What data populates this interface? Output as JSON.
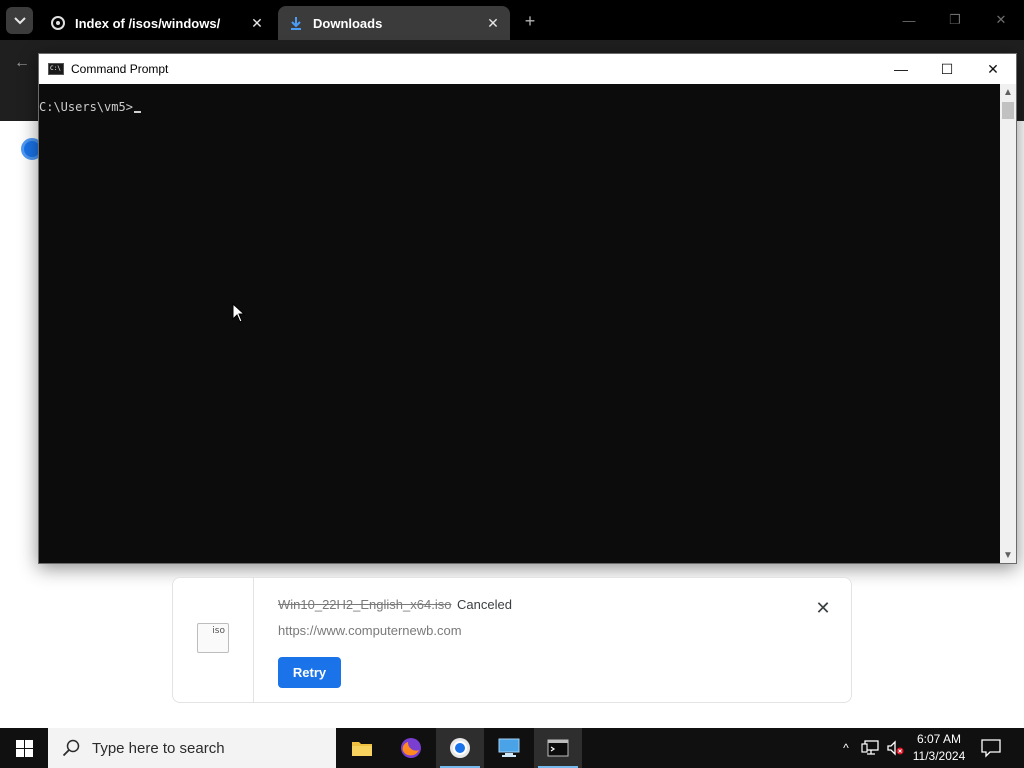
{
  "browser": {
    "tabs": [
      {
        "title": "Index of /isos/windows/",
        "active": false
      },
      {
        "title": "Downloads",
        "active": true
      }
    ],
    "new_tab_symbol": "+",
    "window_controls": {
      "minimize": "—",
      "restore": "❐",
      "close": "✕"
    },
    "back_symbol": "←"
  },
  "cmd": {
    "title": "Command Prompt",
    "prompt": "C:\\Users\\vm5>",
    "controls": {
      "minimize": "—",
      "maximize": "☐",
      "close": "✕"
    },
    "scroll_up": "▲",
    "scroll_down": "▼"
  },
  "download": {
    "file_name": "Win10_22H2_English_x64.iso",
    "status": "Canceled",
    "url": "https://www.computernewb.com",
    "retry_label": "Retry",
    "file_icon_label": "iso",
    "remove_symbol": "✕"
  },
  "taskbar": {
    "search_placeholder": "Type here to search",
    "apps": [
      "file-explorer",
      "firefox",
      "chrome",
      "remote-desktop",
      "command-prompt"
    ],
    "active_app": "command-prompt",
    "clock_time": "6:07 AM",
    "clock_date": "11/3/2024",
    "tray_chevron": "^"
  },
  "colors": {
    "accent": "#1a73e8",
    "taskbar_bg": "#101010",
    "tab_strip_bg": "#000000",
    "active_tab_bg": "#3b3b3b",
    "cmd_bg": "#0c0c0c"
  }
}
